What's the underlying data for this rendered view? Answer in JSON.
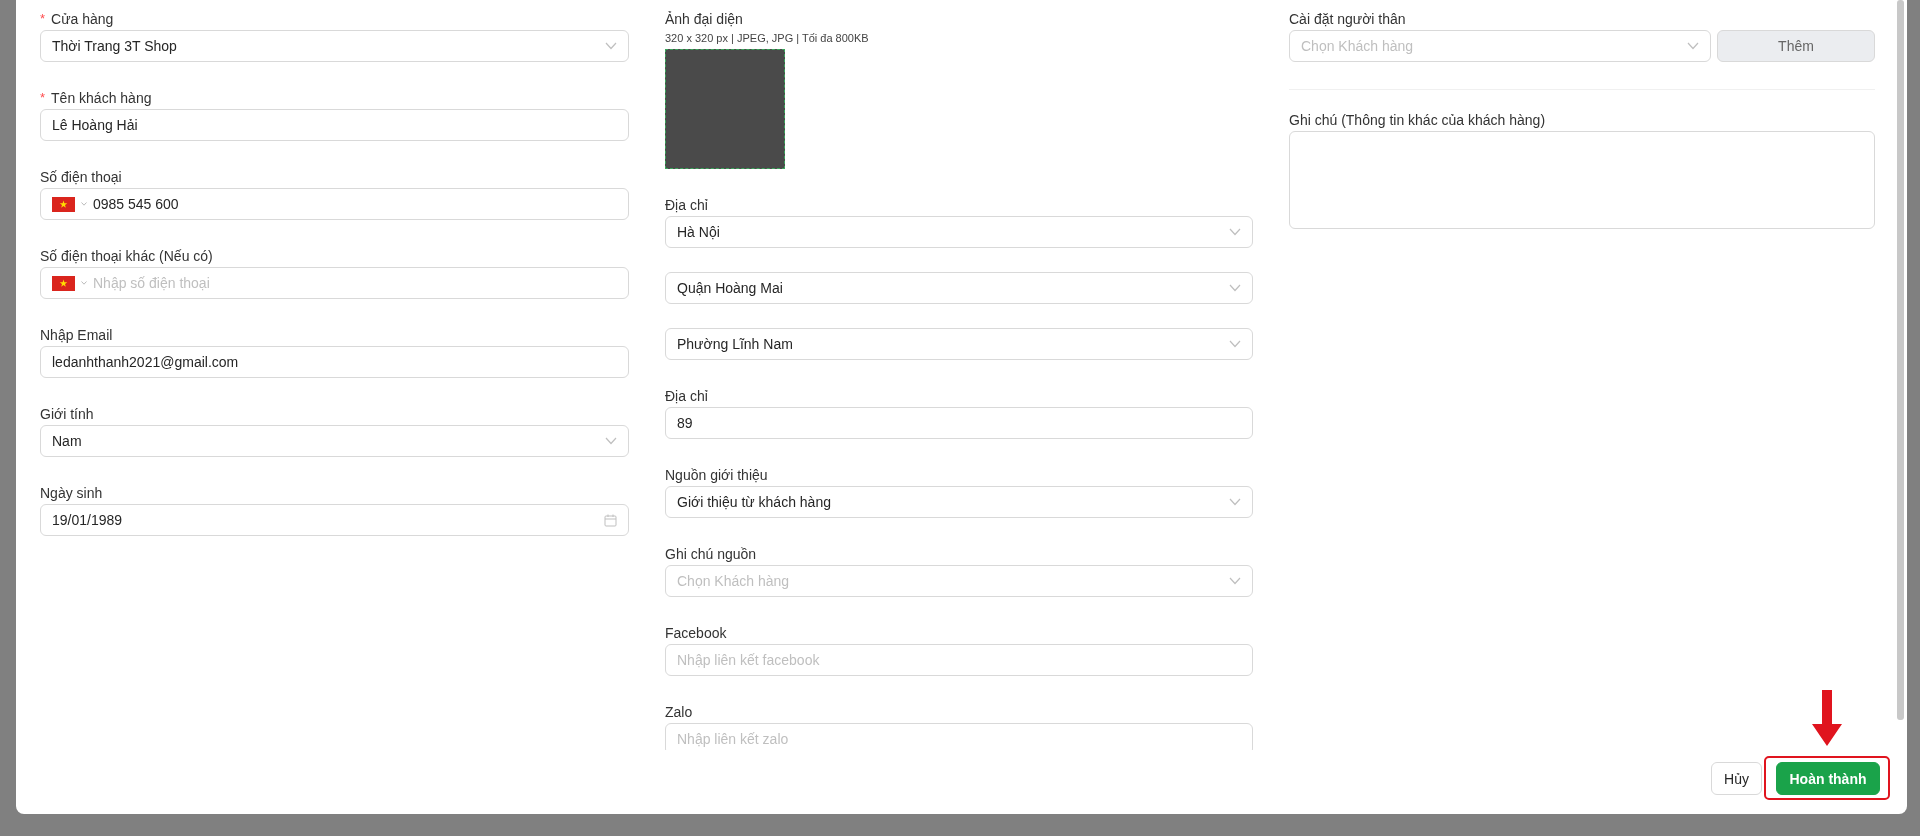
{
  "columns": [
    {
      "fields": [
        {
          "kind": "select",
          "label": "Cửa hàng",
          "required_mark": "*",
          "value": "Thời Trang 3T Shop"
        },
        {
          "kind": "text",
          "label": "Tên khách hàng",
          "required_mark": "*",
          "value": "Lê Hoàng Hải"
        },
        {
          "kind": "phone",
          "label": "Số điện thoại",
          "value": "0985 545 600"
        },
        {
          "kind": "phone",
          "label": "Số điện thoại khác (Nếu có)",
          "placeholder": "Nhập số điện thoại"
        },
        {
          "kind": "text",
          "label": "Nhập Email",
          "value": "ledanhthanh2021@gmail.com"
        },
        {
          "kind": "select",
          "label": "Giới tính",
          "value": "Nam"
        },
        {
          "kind": "date",
          "label": "Ngày sinh",
          "value": "19/01/1989"
        }
      ]
    },
    {
      "fields": [
        {
          "kind": "avatar",
          "label": "Ảnh đại diện",
          "hint": "320 x 320 px | JPEG, JPG | Tối đa 800KB"
        },
        {
          "kind": "select",
          "label": "Địa chỉ",
          "value": "Hà Nội"
        },
        {
          "kind": "select",
          "value": "Quận Hoàng Mai"
        },
        {
          "kind": "select",
          "value": "Phường Lĩnh Nam"
        },
        {
          "kind": "text",
          "label": "Địa chỉ",
          "value": "89"
        },
        {
          "kind": "select",
          "label": "Nguồn giới thiệu",
          "value": "Giới thiệu từ khách hàng"
        },
        {
          "kind": "select",
          "label": "Ghi chú nguồn",
          "placeholder": "Chọn Khách hàng"
        },
        {
          "kind": "text",
          "label": "Facebook",
          "placeholder": "Nhập liên kết facebook"
        },
        {
          "kind": "text",
          "label": "Zalo",
          "placeholder": "Nhập liên kết zalo"
        }
      ]
    },
    {
      "fields": [
        {
          "kind": "select-button",
          "label": "Cài đặt người thân",
          "placeholder": "Chọn Khách hàng",
          "button": {
            "label": "Thêm",
            "disabled": true
          }
        },
        {
          "kind": "divider"
        },
        {
          "kind": "textarea",
          "label": "Ghi chú (Thông tin khác của khách hàng)"
        }
      ]
    }
  ],
  "footer": {
    "buttons": [
      {
        "kind": "default",
        "label": "Hủy"
      },
      {
        "kind": "primary",
        "label": "Hoàn thành"
      }
    ]
  },
  "annotation": {
    "kind": "arrow-highlight"
  }
}
